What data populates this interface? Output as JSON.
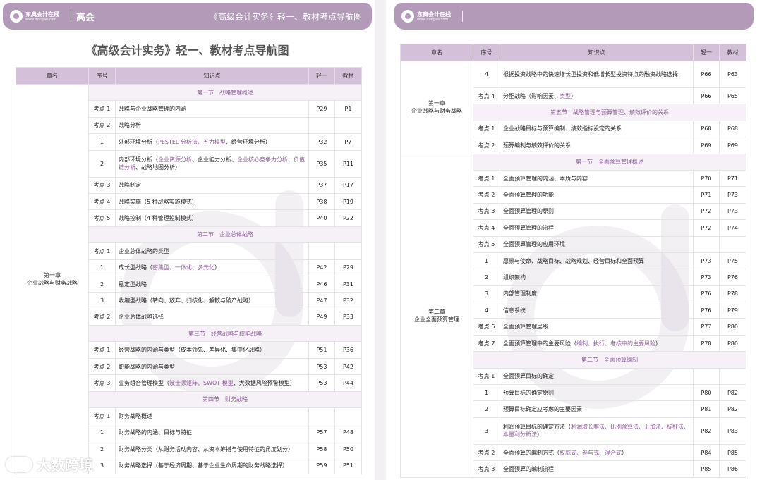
{
  "left_page": {
    "header": {
      "logo_text": "东奥会计在线",
      "logo_sub": "www.dongao.com",
      "level": "高会",
      "title": "《高级会计实务》轻一、教材考点导航图"
    },
    "page_title": "《高级会计实务》轻一、教材考点导航图",
    "columns": [
      "章名",
      "序号",
      "知识点",
      "轻一",
      "教材"
    ],
    "chapter": [
      "第一章",
      "企业战略与财务战略"
    ],
    "rows": [
      {
        "type": "section",
        "text": "第一节　战略管理概述"
      },
      {
        "type": "row",
        "no": "考点 1",
        "parts": [
          {
            "t": "战略与企业战略管理的内涵"
          }
        ],
        "q": "P29",
        "b": "P1"
      },
      {
        "type": "row",
        "no": "考点 2",
        "parts": [
          {
            "t": "战略分析"
          }
        ],
        "q": "",
        "b": ""
      },
      {
        "type": "row",
        "no": "1",
        "parts": [
          {
            "t": "外部环境分析（"
          },
          {
            "t": "PESTEL 分析法、五力模型",
            "h": true
          },
          {
            "t": "、经营环境分析）"
          }
        ],
        "q": "P32",
        "b": "P7"
      },
      {
        "type": "row",
        "tall": true,
        "no": "2",
        "parts": [
          {
            "t": "内部环境分析（"
          },
          {
            "t": "企业资源分析",
            "h": true
          },
          {
            "t": "、企业能力分析、"
          },
          {
            "t": "企业核心竞争力分析、价值链分析",
            "h": true
          },
          {
            "t": "、战略地图分析）"
          }
        ],
        "q": "P35",
        "b": "P11"
      },
      {
        "type": "row",
        "no": "考点 3",
        "parts": [
          {
            "t": "战略制定"
          }
        ],
        "q": "P37",
        "b": "P17"
      },
      {
        "type": "row",
        "no": "考点 4",
        "parts": [
          {
            "t": "战略实施（5 种战略实施模式）"
          }
        ],
        "q": "P38",
        "b": "P19"
      },
      {
        "type": "row",
        "no": "考点 5",
        "parts": [
          {
            "t": "战略控制（4 种管理控制模式）"
          }
        ],
        "q": "P40",
        "b": "P22"
      },
      {
        "type": "section",
        "text": "第二节　企业总体战略"
      },
      {
        "type": "row",
        "no": "考点 1",
        "parts": [
          {
            "t": "企业总体战略的类型"
          }
        ],
        "q": "",
        "b": ""
      },
      {
        "type": "row",
        "no": "1",
        "parts": [
          {
            "t": "成长型战略（"
          },
          {
            "t": "密集型、一体化、多元化",
            "h": true
          },
          {
            "t": "）"
          }
        ],
        "q": "P42",
        "b": "P29"
      },
      {
        "type": "row",
        "no": "2",
        "parts": [
          {
            "t": "稳定型战略"
          }
        ],
        "q": "P46",
        "b": "P31"
      },
      {
        "type": "row",
        "no": "3",
        "parts": [
          {
            "t": "收缩型战略（转向、放弃、归核化、解散与破产战略）"
          }
        ],
        "q": "P47",
        "b": "P32"
      },
      {
        "type": "row",
        "no": "考点 2",
        "parts": [
          {
            "t": "企业总体战略选择"
          }
        ],
        "q": "P49",
        "b": "P33"
      },
      {
        "type": "section",
        "text": "第三节　经营战略与职能战略"
      },
      {
        "type": "row",
        "no": "考点 1",
        "parts": [
          {
            "t": "经营战略的内涵与类型（成本领先、差异化、集中化战略）"
          }
        ],
        "q": "P51",
        "b": "P36"
      },
      {
        "type": "row",
        "no": "考点 2",
        "parts": [
          {
            "t": "职能战略的内涵与类型"
          }
        ],
        "q": "P53",
        "b": "P42"
      },
      {
        "type": "row",
        "no": "考点 3",
        "parts": [
          {
            "t": "业务组合管理模型（"
          },
          {
            "t": "波士顿矩阵、SWOT 模型",
            "h": true
          },
          {
            "t": "、大数据风险预警模型）"
          }
        ],
        "q": "P53",
        "b": "P44"
      },
      {
        "type": "section",
        "text": "第四节　财务战略"
      },
      {
        "type": "row",
        "no": "考点 1",
        "parts": [
          {
            "t": "财务战略概述"
          }
        ],
        "q": "",
        "b": ""
      },
      {
        "type": "row",
        "no": "1",
        "parts": [
          {
            "t": "财务战略的内涵、目标与特征"
          }
        ],
        "q": "P57",
        "b": "P48"
      },
      {
        "type": "row",
        "no": "2",
        "parts": [
          {
            "t": "财务战略分类（从财务活动内容、从资本筹措与使用特征的角度划分）"
          }
        ],
        "q": "P58",
        "b": "P50"
      },
      {
        "type": "row",
        "no": "3",
        "parts": [
          {
            "t": "财务战略选择（基于经济周期、基于企业生命周期的财务战略选择）"
          }
        ],
        "q": "P59",
        "b": "P51"
      }
    ]
  },
  "right_page": {
    "header": {
      "logo_text": "东奥会计在线",
      "logo_sub": "www.dongao.com"
    },
    "columns": [
      "章名",
      "序号",
      "知识点",
      "轻一",
      "教材"
    ],
    "chapter1": [
      "第一章",
      "企业战略与财务战略"
    ],
    "chapter2": [
      "第二章",
      "企业全面预算管理"
    ],
    "rows_ch1": [
      {
        "type": "row",
        "tall": true,
        "no": "4",
        "parts": [
          {
            "t": "根据投资战略中的快速增长型投资和低增长型投资特点的融资战略选择"
          }
        ],
        "q": "P66",
        "b": "P63"
      },
      {
        "type": "row",
        "no": "考点 4",
        "parts": [
          {
            "t": "分配战略（影响因素、"
          },
          {
            "t": "类型",
            "h": true
          },
          {
            "t": "）"
          }
        ],
        "q": "P66",
        "b": "P65"
      },
      {
        "type": "section",
        "text": "第五节　战略管理与预算管理、绩效评价的关系"
      },
      {
        "type": "row",
        "no": "考点 1",
        "parts": [
          {
            "t": "企业战略目标与预算编制、绩效指标设定的关系"
          }
        ],
        "q": "P68",
        "b": "P68"
      },
      {
        "type": "row",
        "no": "考点 2",
        "parts": [
          {
            "t": "预算编制与绩效评价的关系"
          }
        ],
        "q": "P69",
        "b": "P69"
      }
    ],
    "rows_ch2": [
      {
        "type": "section",
        "text": "第一节　全面预算管理概述"
      },
      {
        "type": "row",
        "no": "考点 1",
        "parts": [
          {
            "t": "全面预算管理的内涵、本质与内容"
          }
        ],
        "q": "P70",
        "b": "P71"
      },
      {
        "type": "row",
        "no": "考点 2",
        "parts": [
          {
            "t": "全面预算管理的功能"
          }
        ],
        "q": "P71",
        "b": "P73"
      },
      {
        "type": "row",
        "no": "考点 3",
        "parts": [
          {
            "t": "全面预算管理的原则"
          }
        ],
        "q": "P72",
        "b": "P73"
      },
      {
        "type": "row",
        "no": "考点 4",
        "parts": [
          {
            "t": "全面预算管理的流程"
          }
        ],
        "q": "P72",
        "b": "P74"
      },
      {
        "type": "row",
        "no": "考点 5",
        "parts": [
          {
            "t": "全面预算管理的应用环境"
          }
        ],
        "q": "",
        "b": ""
      },
      {
        "type": "row",
        "no": "1",
        "parts": [
          {
            "t": "愿景与使命、战略目标、战略规划、经营目标和全面预算"
          }
        ],
        "q": "P73",
        "b": "P75"
      },
      {
        "type": "row",
        "no": "2",
        "parts": [
          {
            "t": "组织架构"
          }
        ],
        "q": "P73",
        "b": "P76"
      },
      {
        "type": "row",
        "no": "3",
        "parts": [
          {
            "t": "内部管理制度"
          }
        ],
        "q": "P76",
        "b": "P78"
      },
      {
        "type": "row",
        "no": "4",
        "parts": [
          {
            "t": "信息系统"
          }
        ],
        "q": "P76",
        "b": "P79"
      },
      {
        "type": "row",
        "no": "考点 6",
        "parts": [
          {
            "t": "全面预算管理层级"
          }
        ],
        "q": "P77",
        "b": "P80"
      },
      {
        "type": "row",
        "no": "考点 7",
        "parts": [
          {
            "t": "全面预算管理中的主要风险（"
          },
          {
            "t": "编制、执行、考核中的主要风险",
            "h": true
          },
          {
            "t": "）"
          }
        ],
        "q": "P78",
        "b": "P80"
      },
      {
        "type": "section",
        "text": "第二节　全面预算编制"
      },
      {
        "type": "row",
        "no": "考点 1",
        "parts": [
          {
            "t": "全面预算目标的确定"
          }
        ],
        "q": "",
        "b": ""
      },
      {
        "type": "row",
        "no": "1",
        "parts": [
          {
            "t": "预算目标的确定原则"
          }
        ],
        "q": "P80",
        "b": "P82"
      },
      {
        "type": "row",
        "no": "2",
        "parts": [
          {
            "t": "预算目标确定应考虑的主要因素"
          }
        ],
        "q": "P81",
        "b": "P82"
      },
      {
        "type": "row",
        "tall": true,
        "no": "3",
        "parts": [
          {
            "t": "利润预算目标的确定方法（"
          },
          {
            "t": "利润增长率法、比例预算法、上加法、标杆法、本量利分析法",
            "h": true
          },
          {
            "t": "）"
          }
        ],
        "q": "P82",
        "b": "P83"
      },
      {
        "type": "row",
        "no": "考点 2",
        "parts": [
          {
            "t": "全面预算的编制方式（"
          },
          {
            "t": "权威式、参与式、混合式",
            "h": true
          },
          {
            "t": "）"
          }
        ],
        "q": "P84",
        "b": "P85"
      },
      {
        "type": "row",
        "no": "考点 3",
        "parts": [
          {
            "t": "全面预算的编制流程"
          }
        ],
        "q": "P85",
        "b": "P86"
      }
    ]
  },
  "corner_brand": "大数跨境"
}
